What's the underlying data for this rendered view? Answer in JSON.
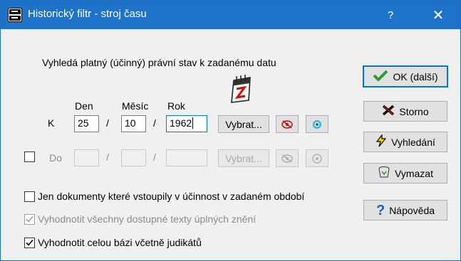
{
  "window": {
    "title": "Historický filtr - stroj času",
    "help_label": "?",
    "close_label": "✕"
  },
  "description": "Vyhledá platný (účinný) právní stav k zadanému datu",
  "headers": {
    "day": "Den",
    "month": "Měsíc",
    "year": "Rok"
  },
  "from_row": {
    "label": "K",
    "day": "25",
    "month": "10",
    "year": "1962",
    "select_label": "Vybrat..."
  },
  "to_row": {
    "label": "Do",
    "day": "",
    "month": "",
    "year": "",
    "select_label": "Vybrat...",
    "checked": false
  },
  "date_separator": "/",
  "options": [
    {
      "label": "Jen dokumenty které vstoupily v účinnost v zadaném období",
      "checked": false,
      "enabled": true
    },
    {
      "label": "Vyhodnotit všechny dostupné texty úplných znění",
      "checked": true,
      "enabled": false
    },
    {
      "label": "Vyhodnotit celou bázi včetně judikátů",
      "checked": true,
      "enabled": true
    }
  ],
  "buttons": {
    "ok": "OK (další)",
    "cancel": "Storno",
    "search": "Vyhledání",
    "clear": "Vymazat",
    "help": "Nápověda"
  },
  "icons": {
    "app": "app-hist-icon",
    "calendar": "calendar-icon",
    "eye_off": "eye-off-icon",
    "target": "target-icon",
    "ok": "checkmark-icon",
    "cancel": "x-mark-icon",
    "search": "lightning-icon",
    "clear": "recycle-bin-icon",
    "help": "question-mark-icon"
  },
  "colors": {
    "titlebar": "#1e73c8",
    "accent": "#0078d7",
    "ok_green": "#2e9d2e",
    "cancel_red": "#cc1111"
  }
}
